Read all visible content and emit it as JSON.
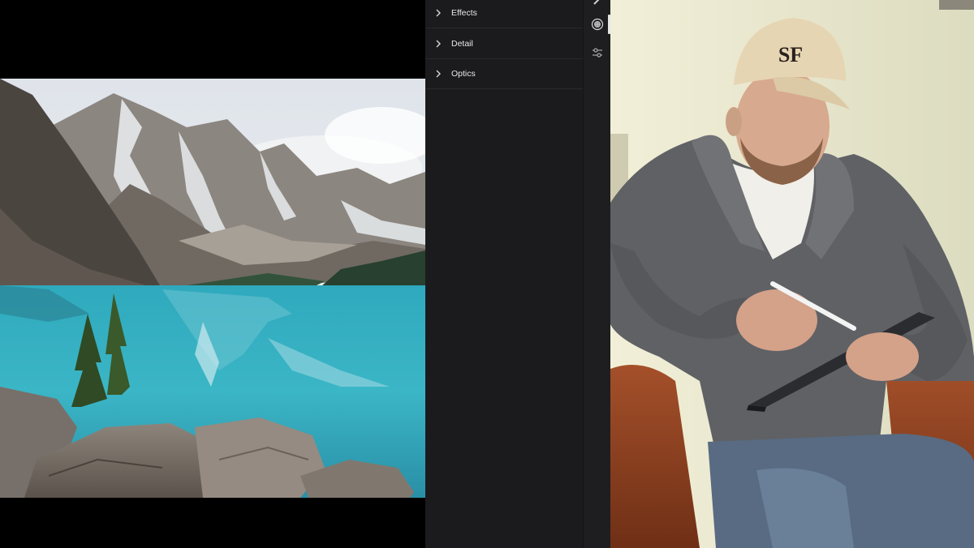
{
  "edit_panel": {
    "sections": [
      {
        "label": "Effects",
        "expanded": false
      },
      {
        "label": "Detail",
        "expanded": false
      },
      {
        "label": "Optics",
        "expanded": false
      }
    ]
  },
  "tool_rail": {
    "icons": [
      "brush-icon",
      "masking-icon",
      "presets-icon"
    ],
    "active": "masking-icon"
  },
  "photo": {
    "subject": "mountain lake landscape photo"
  },
  "presenter": {
    "cap_logo": "SF"
  },
  "colors": {
    "panel_bg": "#1b1b1d",
    "rail_bg": "#1e1e20",
    "text": "#e8e8e8",
    "divider": "#2a2a2c"
  }
}
